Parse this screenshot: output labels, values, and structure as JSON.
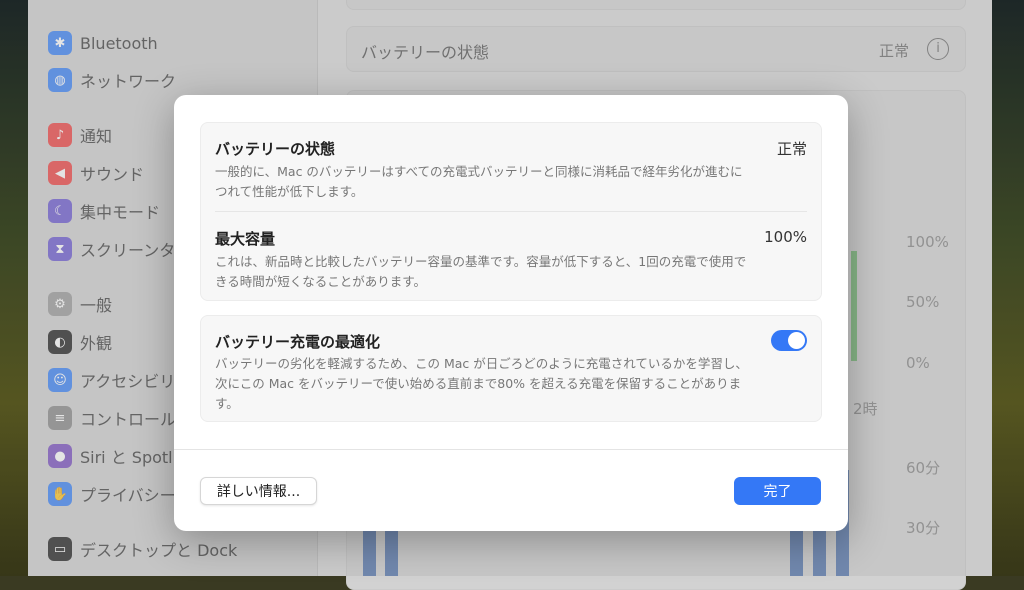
{
  "sidebar": {
    "items": [
      {
        "label": "Bluetooth",
        "icon": "bluetooth-icon",
        "color": "#3b82f6"
      },
      {
        "label": "ネットワーク",
        "icon": "globe-icon",
        "color": "#3b82f6"
      },
      {
        "label": "通知",
        "icon": "bell-icon",
        "color": "#ef4444"
      },
      {
        "label": "サウンド",
        "icon": "speaker-icon",
        "color": "#ef4444"
      },
      {
        "label": "集中モード",
        "icon": "moon-icon",
        "color": "#6d5bd0"
      },
      {
        "label": "スクリーンタ",
        "icon": "hourglass-icon",
        "color": "#6d5bd0"
      },
      {
        "label": "一般",
        "icon": "gear-icon",
        "color": "#9a9a9a"
      },
      {
        "label": "外観",
        "icon": "appearance-icon",
        "color": "#222222"
      },
      {
        "label": "アクセシビリ",
        "icon": "accessibility-icon",
        "color": "#3b82f6"
      },
      {
        "label": "コントロール",
        "icon": "control-center-icon",
        "color": "#8a8a8a"
      },
      {
        "label": "Siri と Spotl",
        "icon": "siri-icon",
        "color": "#7a4fbf"
      },
      {
        "label": "プライバシー",
        "icon": "hand-icon",
        "color": "#3b82f6"
      },
      {
        "label": "デスクトップと Dock",
        "icon": "desktop-icon",
        "color": "#222222"
      }
    ]
  },
  "main": {
    "battery_status_label": "バッテリーの状態",
    "battery_status_value": "正常",
    "chart_labels": {
      "pct100": "100%",
      "pct50": "50%",
      "pct0": "0%",
      "time": "2時",
      "min60": "60分",
      "min30": "30分"
    }
  },
  "dialog": {
    "health": {
      "title": "バッテリーの状態",
      "value": "正常",
      "desc": "一般的に、Mac のバッテリーはすべての充電式バッテリーと同様に消耗品で経年劣化が進むにつれて性能が低下します。"
    },
    "capacity": {
      "title": "最大容量",
      "value": "100%",
      "desc": "これは、新品時と比較したバッテリー容量の基準です。容量が低下すると、1回の充電で使用できる時間が短くなることがあります。"
    },
    "optimize": {
      "title": "バッテリー充電の最適化",
      "enabled": true,
      "desc": "バッテリーの劣化を軽減するため、この Mac が日ごろどのように充電されているかを学習し、次にこの Mac をバッテリーで使い始める直前まで80% を超える充電を保留することがあります。"
    },
    "more_info": "詳しい情報...",
    "done": "完了",
    "accent": "#3478f6"
  }
}
